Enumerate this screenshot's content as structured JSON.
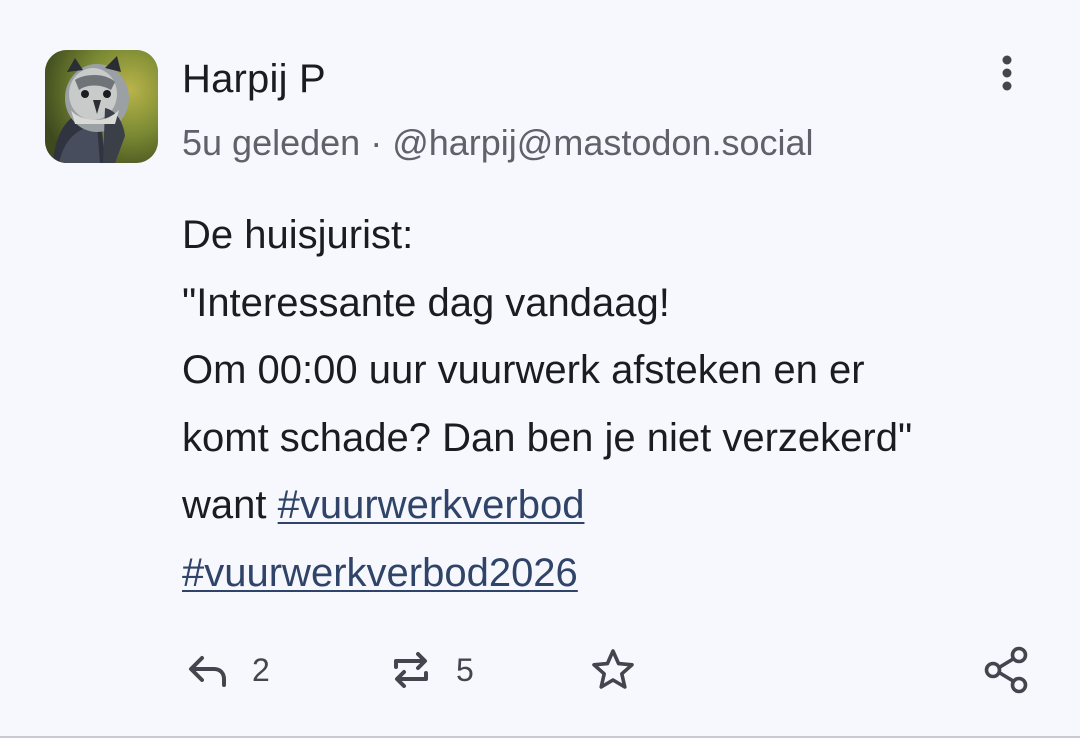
{
  "post": {
    "author": {
      "display_name": "Harpij P",
      "avatar_icon": "harpy-eagle-avatar"
    },
    "time_ago": "5u geleden",
    "separator": "·",
    "handle": "@harpij@mastodon.social",
    "content": {
      "line1": "De huisjurist:",
      "line2": "\"Interessante dag vandaag!",
      "line3": "Om 00:00 uur vuurwerk afsteken en er",
      "line4": "komt schade? Dan ben je niet verzekerd\"",
      "line5_prefix": "want",
      "hashtag1": "#vuurwerkverbod",
      "hashtag2": "#vuurwerkverbod2026"
    },
    "actions": {
      "reply_count": "2",
      "boost_count": "5",
      "reply_icon": "reply-icon",
      "boost_icon": "boost-icon",
      "favourite_icon": "star-icon",
      "share_icon": "share-icon",
      "more_icon": "more-vertical-icon"
    }
  },
  "colors": {
    "background": "#f7f8fd",
    "text": "#1b1c20",
    "meta": "#5f616b",
    "hashtag": "#2f4468",
    "icon": "#44464f"
  }
}
